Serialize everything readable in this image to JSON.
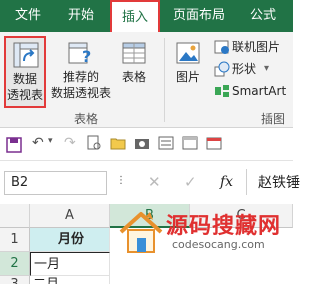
{
  "tabs": [
    {
      "label": "文件"
    },
    {
      "label": "开始"
    },
    {
      "label": "插入"
    },
    {
      "label": "页面布局"
    },
    {
      "label": "公式"
    }
  ],
  "ribbon": {
    "pivot_table": {
      "line1": "数据",
      "line2": "透视表"
    },
    "recommended_pivot": {
      "line1": "推荐的",
      "line2": "数据透视表"
    },
    "table": {
      "label": "表格"
    },
    "picture": {
      "label": "图片"
    },
    "online_picture": {
      "label": "联机图片"
    },
    "shapes": {
      "label": "形状"
    },
    "smartart": {
      "label": "SmartArt"
    },
    "group_tables": "表格",
    "group_illustrations": "插图"
  },
  "formula_bar": {
    "name_box": "B2",
    "fx": "fx",
    "content": "赵铁锤"
  },
  "grid": {
    "columns": [
      "A",
      "B",
      "C"
    ],
    "rows": [
      {
        "num": "1",
        "a": "月份"
      },
      {
        "num": "2",
        "a": "一月"
      },
      {
        "num": "3",
        "a": "二月"
      }
    ]
  },
  "watermark": {
    "title": "源码搜藏网",
    "url": "codesocang.com"
  },
  "colors": {
    "excel_green": "#217346",
    "highlight_red": "#e23a3a",
    "header_cyan": "#cfeef0"
  }
}
